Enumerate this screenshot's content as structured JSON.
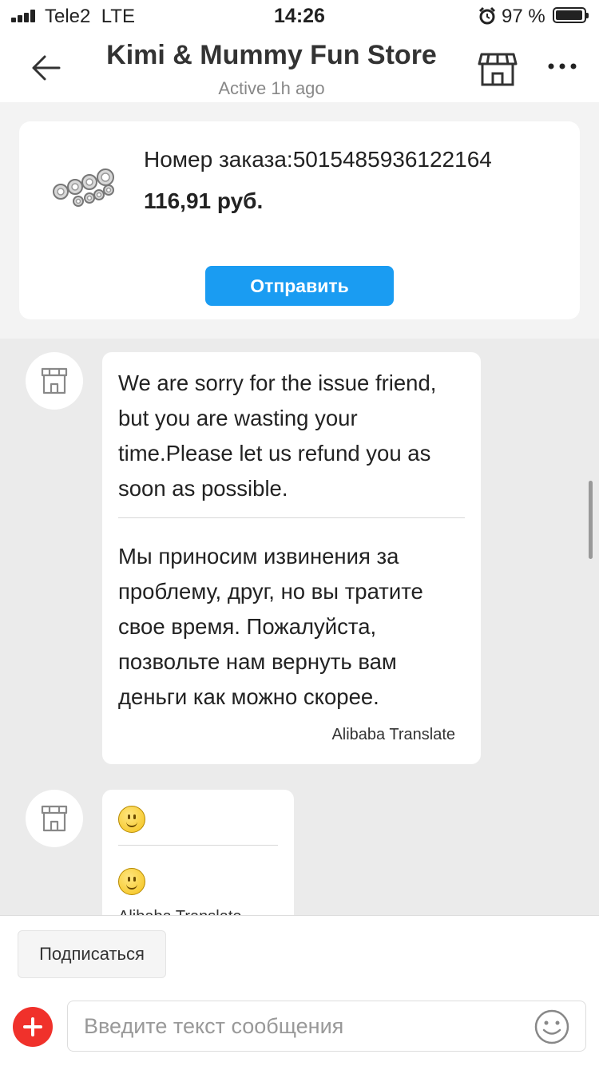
{
  "status_bar": {
    "carrier": "Tele2",
    "network": "LTE",
    "time": "14:26",
    "battery_percent": "97 %",
    "battery_level": 0.97,
    "icons": [
      "signal-icon",
      "alarm-icon",
      "battery-icon"
    ]
  },
  "header": {
    "title": "Kimi & Mummy Fun Store",
    "subtitle": "Active 1h ago",
    "icons": [
      "back-arrow-icon",
      "store-icon",
      "more-icon"
    ]
  },
  "order": {
    "number": "Номер заказа:5015485936122164",
    "price": "116,91 руб.",
    "send_label": "Отправить",
    "product_image_icon": "bearings-product-icon"
  },
  "messages": [
    {
      "sender_icon": "store-avatar-icon",
      "original": "We are sorry for the issue friend, but you are wasting your time.Please let us refund you as soon as possible.",
      "translated": "Мы приносим извинения за проблему, друг, но вы тратите свое время. Пожалуйста, позвольте нам вернуть вам деньги как можно скорее.",
      "translator": "Alibaba Translate"
    },
    {
      "sender_icon": "store-avatar-icon",
      "original_icon": "smiley-emoji-icon",
      "translated_icon": "smiley-emoji-icon",
      "translator": "Alibaba Translate"
    }
  ],
  "bottom": {
    "subscribe_label": "Подписаться",
    "input_placeholder": "Введите текст сообщения",
    "input_value": "",
    "icons": [
      "plus-icon",
      "emoji-icon"
    ]
  },
  "colors": {
    "accent_blue": "#1a9cf2",
    "plus_red": "#f0312b",
    "background": "#ebebeb"
  }
}
